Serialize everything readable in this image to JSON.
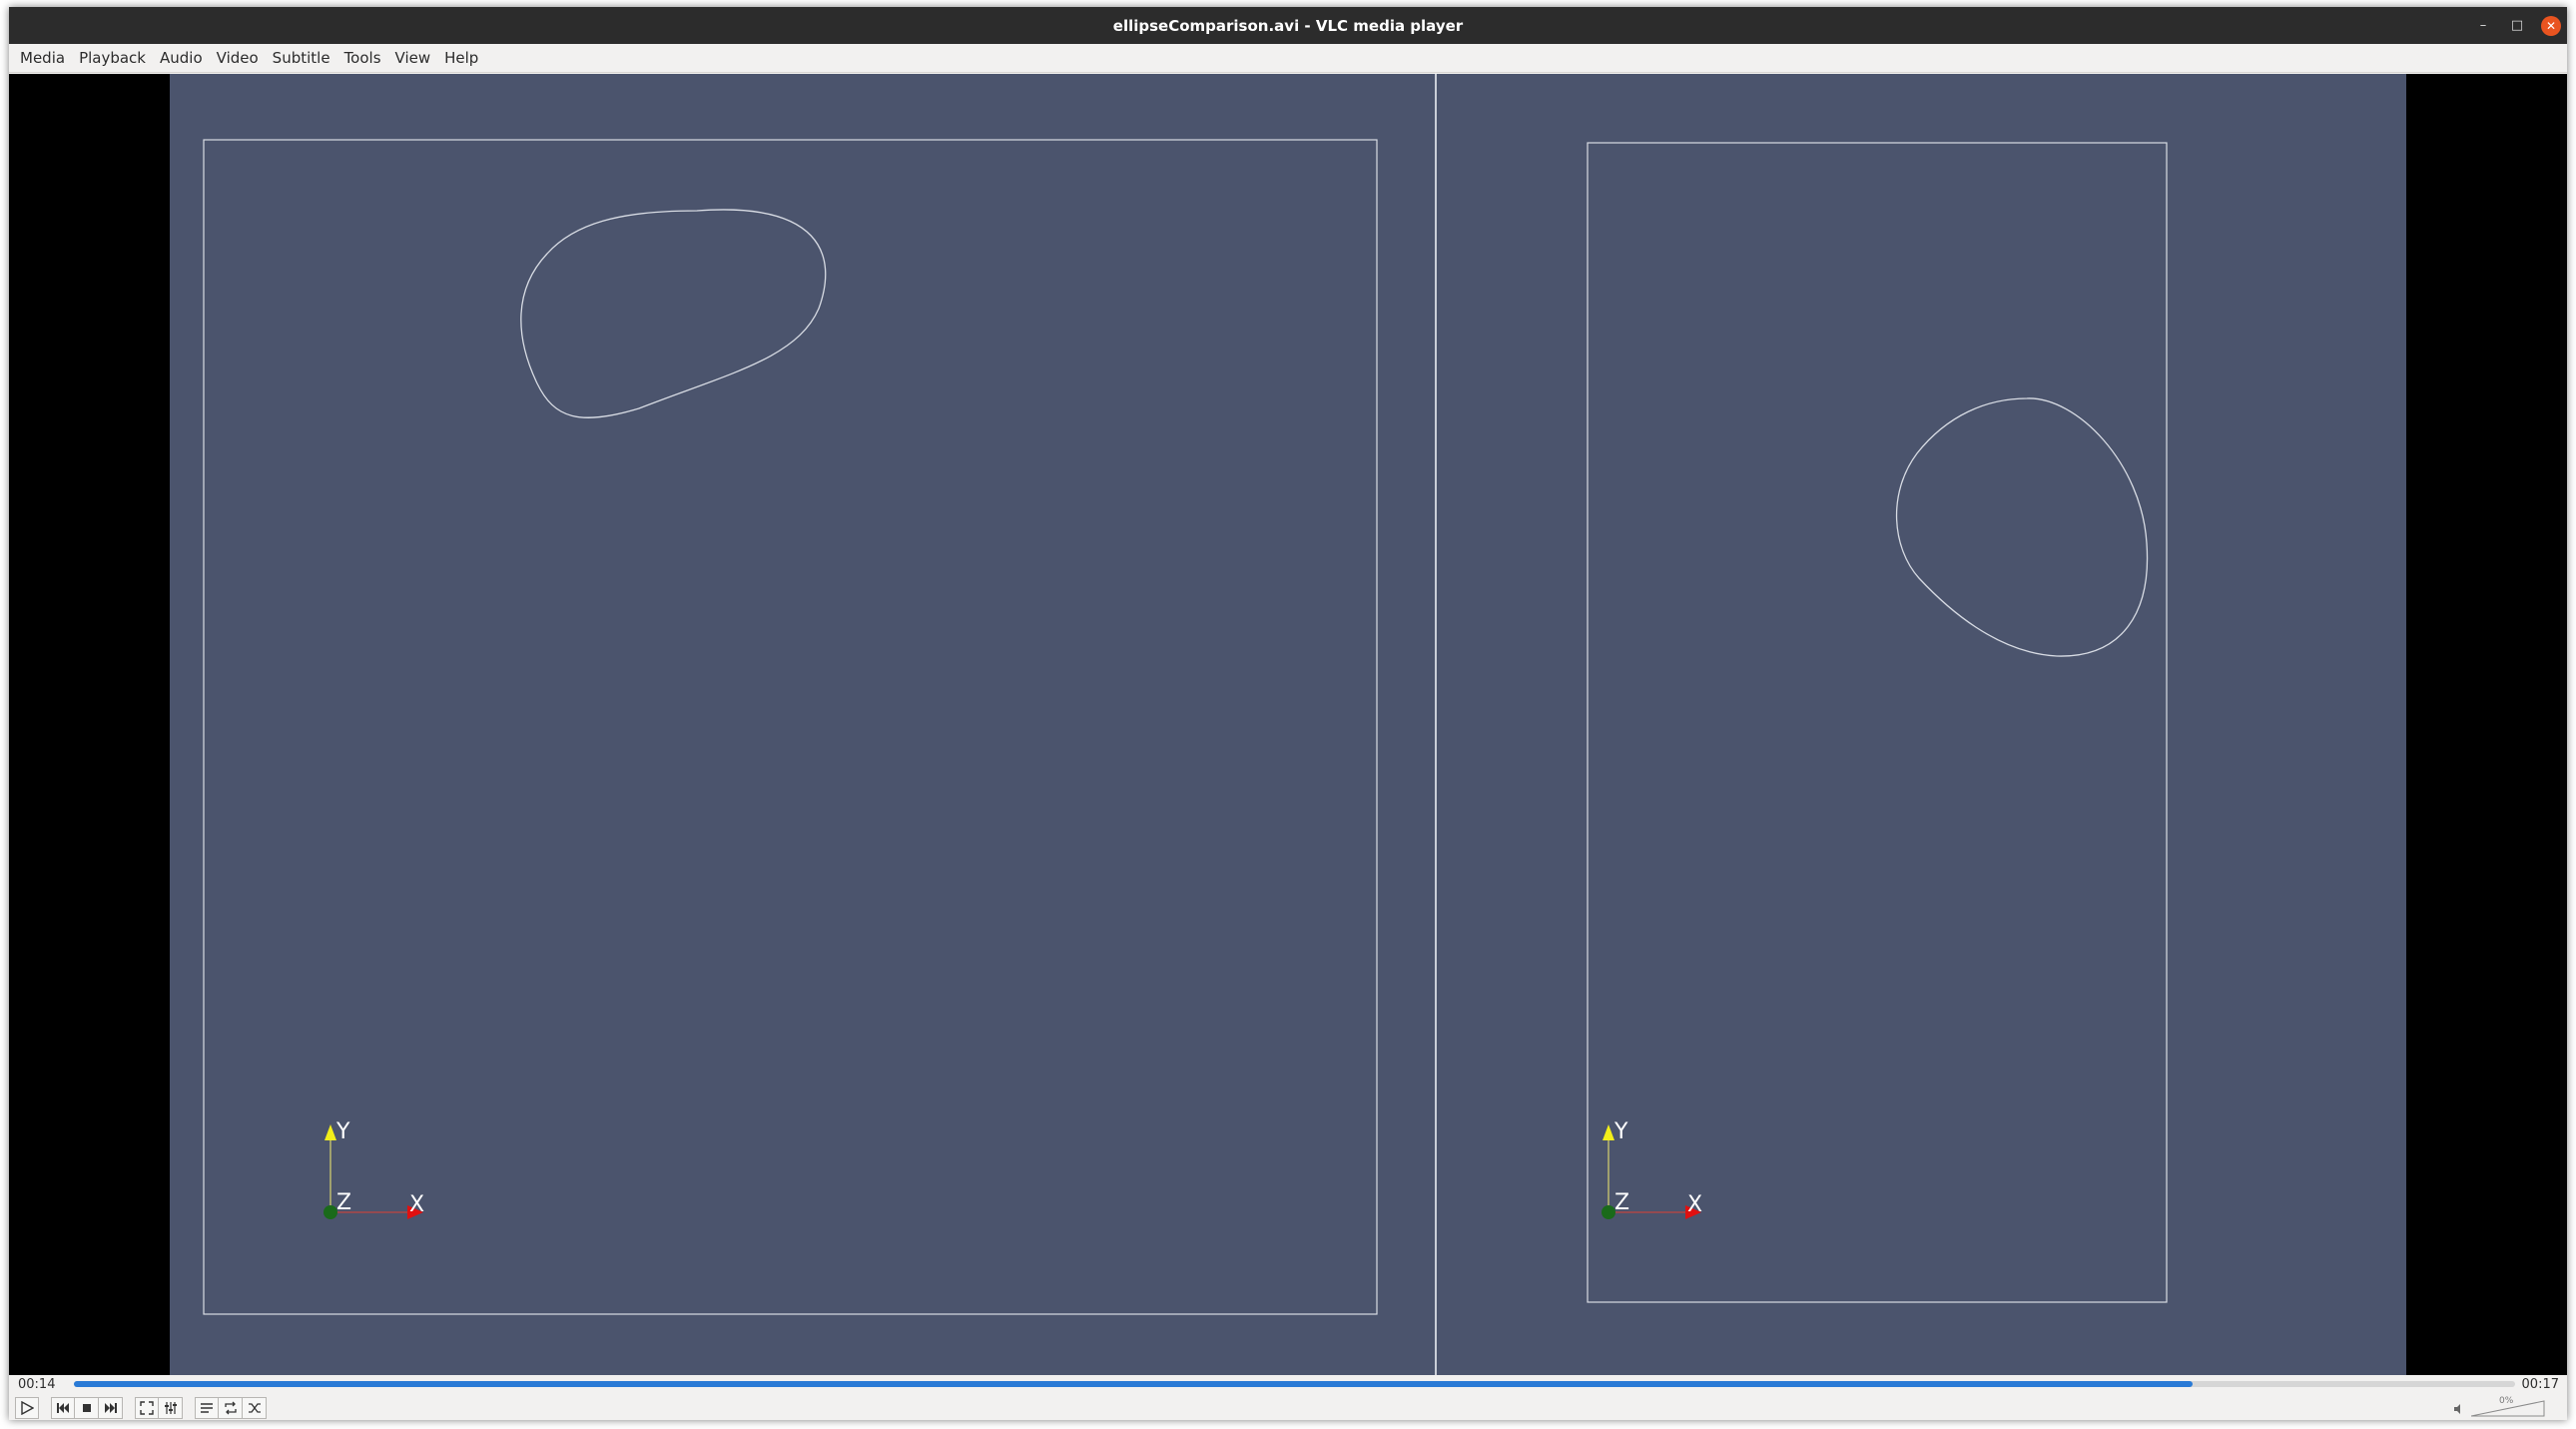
{
  "window": {
    "title": "ellipseComparison.avi - VLC media player",
    "controls": {
      "minimize": "–",
      "maximize": "□",
      "close": "✕"
    }
  },
  "menu": {
    "items": [
      {
        "label": "Media"
      },
      {
        "label": "Playback"
      },
      {
        "label": "Audio"
      },
      {
        "label": "Video"
      },
      {
        "label": "Subtitle"
      },
      {
        "label": "Tools"
      },
      {
        "label": "View"
      },
      {
        "label": "Help"
      }
    ]
  },
  "video": {
    "background_color": "#4b546d",
    "line_color": "#d8dce4",
    "axes": {
      "left": {
        "y_label": "Y",
        "z_label": "Z",
        "x_label": "X"
      },
      "right": {
        "y_label": "Y",
        "z_label": "Z",
        "x_label": "X"
      }
    }
  },
  "playback": {
    "elapsed": "00:14",
    "total": "00:17",
    "progress_fraction": 0.868,
    "accent_color": "#2a7ad6"
  },
  "volume": {
    "label": "0%",
    "level_fraction": 0.0
  },
  "icons": {
    "play": "play-icon",
    "previous": "previous-icon",
    "stop": "stop-icon",
    "next": "next-icon",
    "fullscreen": "fullscreen-icon",
    "extended_settings": "equalizer-icon",
    "playlist": "playlist-icon",
    "loop": "loop-icon",
    "shuffle": "shuffle-icon",
    "volume": "speaker-icon"
  }
}
